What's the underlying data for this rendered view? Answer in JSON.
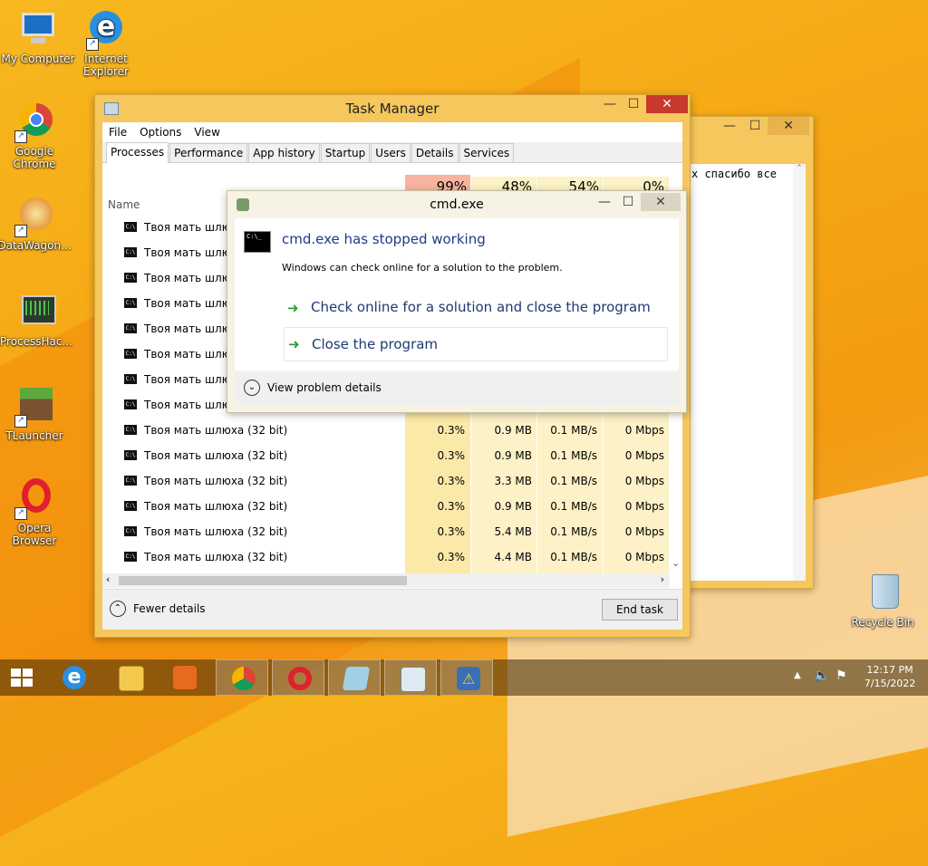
{
  "desktop": {
    "icons": [
      {
        "label": "My Computer"
      },
      {
        "label": "Internet Explorer"
      },
      {
        "label": "Google Chrome"
      },
      {
        "label": "DataWagon..."
      },
      {
        "label": "ProcessHac..."
      },
      {
        "label": "TLauncher"
      },
      {
        "label": "Opera Browser"
      },
      {
        "label": "Recycle Bin"
      }
    ]
  },
  "bg_window": {
    "text": "х спасибо все"
  },
  "task_manager": {
    "title": "Task Manager",
    "menu": [
      "File",
      "Options",
      "View"
    ],
    "tabs": [
      "Processes",
      "Performance",
      "App history",
      "Startup",
      "Users",
      "Details",
      "Services"
    ],
    "column_name": "Name",
    "header_pcts": [
      "99%",
      "48%",
      "54%",
      "0%"
    ],
    "processes": [
      {
        "name": "Твоя мать шлюха",
        "cpu": "",
        "mem": "",
        "disk": "",
        "net": ""
      },
      {
        "name": "Твоя мать шлюха",
        "cpu": "",
        "mem": "",
        "disk": "",
        "net": ""
      },
      {
        "name": "Твоя мать шлюха",
        "cpu": "",
        "mem": "",
        "disk": "",
        "net": ""
      },
      {
        "name": "Твоя мать шлюха",
        "cpu": "",
        "mem": "",
        "disk": "",
        "net": ""
      },
      {
        "name": "Твоя мать шлюха",
        "cpu": "",
        "mem": "",
        "disk": "",
        "net": ""
      },
      {
        "name": "Твоя мать шлюха",
        "cpu": "",
        "mem": "",
        "disk": "",
        "net": ""
      },
      {
        "name": "Твоя мать шлюха",
        "cpu": "",
        "mem": "",
        "disk": "",
        "net": ""
      },
      {
        "name": "Твоя мать шлюха",
        "cpu": "",
        "mem": "",
        "disk": "",
        "net": ""
      },
      {
        "name": "Твоя мать шлюха (32 bit)",
        "cpu": "0.3%",
        "mem": "0.9 MB",
        "disk": "0.1 MB/s",
        "net": "0 Mbps"
      },
      {
        "name": "Твоя мать шлюха (32 bit)",
        "cpu": "0.3%",
        "mem": "0.9 MB",
        "disk": "0.1 MB/s",
        "net": "0 Mbps"
      },
      {
        "name": "Твоя мать шлюха (32 bit)",
        "cpu": "0.3%",
        "mem": "3.3 MB",
        "disk": "0.1 MB/s",
        "net": "0 Mbps"
      },
      {
        "name": "Твоя мать шлюха (32 bit)",
        "cpu": "0.3%",
        "mem": "0.9 MB",
        "disk": "0.1 MB/s",
        "net": "0 Mbps"
      },
      {
        "name": "Твоя мать шлюха (32 bit)",
        "cpu": "0.3%",
        "mem": "5.4 MB",
        "disk": "0.1 MB/s",
        "net": "0 Mbps"
      },
      {
        "name": "Твоя мать шлюха (32 bit)",
        "cpu": "0.3%",
        "mem": "4.4 MB",
        "disk": "0.1 MB/s",
        "net": "0 Mbps"
      }
    ],
    "fewer_details": "Fewer details",
    "end_task": "End task"
  },
  "dialog": {
    "title": "cmd.exe",
    "heading": "cmd.exe has stopped working",
    "message": "Windows can check online for a solution to the problem.",
    "option1": "Check online for a solution and close the program",
    "option2": "Close the program",
    "details": "View problem details"
  },
  "taskbar": {
    "time": "12:17 PM",
    "date": "7/15/2022"
  }
}
